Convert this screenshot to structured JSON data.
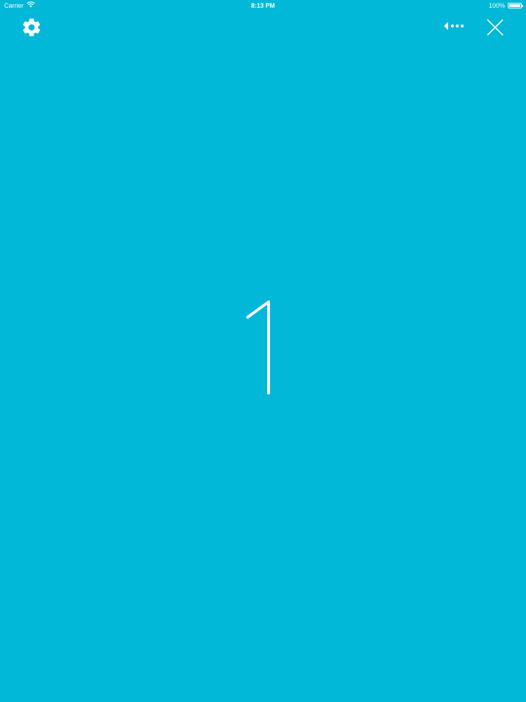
{
  "status_bar": {
    "carrier": "Carrier",
    "time": "8:13 PM",
    "battery": "100%",
    "battery_level": 1.0
  },
  "toolbar": {
    "settings_icon": "gear-icon",
    "back_icon": "backspace-dots-icon",
    "close_icon": "close-icon"
  },
  "main": {
    "counter_value": "1"
  },
  "colors": {
    "background": "#02b8d8",
    "foreground": "#ffffff"
  }
}
